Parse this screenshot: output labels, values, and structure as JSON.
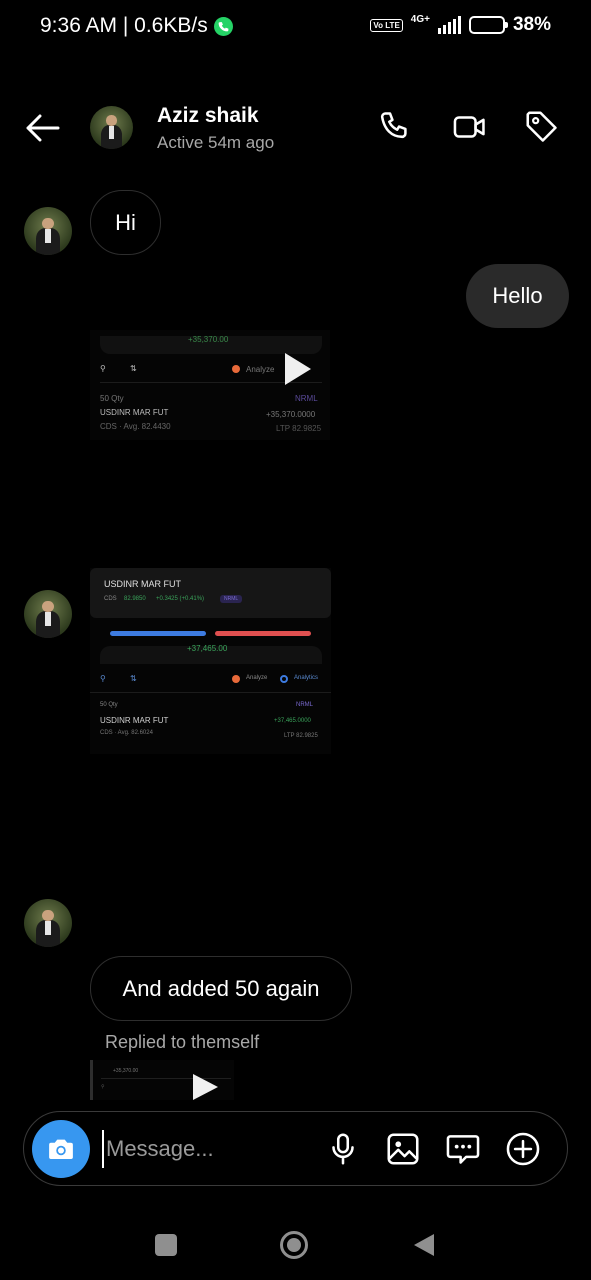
{
  "status_bar": {
    "time_speed": "9:36 AM | 0.6KB/s",
    "volte": "Vo LTE",
    "network": "4G+",
    "battery": "38%",
    "battery_level": 0.38
  },
  "header": {
    "contact_name": "Aziz shaik",
    "contact_status": "Active 54m ago"
  },
  "messages": {
    "m1": "Hi",
    "m2": "Hello",
    "m3": "And added 50 again",
    "replied_note": "Replied to themself"
  },
  "screenshot1": {
    "pnl": "+35,370.00",
    "analyze": "Analyze",
    "qty": "50 Qty",
    "instrument": "USDINR MAR FUT",
    "sub": "CDS · Avg. 82.4430",
    "value": "+35,370.0000",
    "badge": "NRML",
    "ltp": "LTP 82.9825"
  },
  "screenshot2": {
    "title": "USDINR MAR FUT",
    "cds": "CDS",
    "price": "82.9850",
    "change": "+0.3425 (+0.41%)",
    "tag": "NRML",
    "pnl": "+37,465.00",
    "analyze": "Analyze",
    "analytics": "Analytics",
    "qty": "50 Qty",
    "instrument": "USDINR MAR FUT",
    "sub": "CDS · Avg. 82.6024",
    "value": "+37,465.0000",
    "badge": "NRML",
    "ltp": "LTP 82.9825"
  },
  "composer": {
    "placeholder": "Message..."
  },
  "colors": {
    "accent": "#3797f0",
    "background": "#000000",
    "bubble_out": "#2a2a2a"
  }
}
